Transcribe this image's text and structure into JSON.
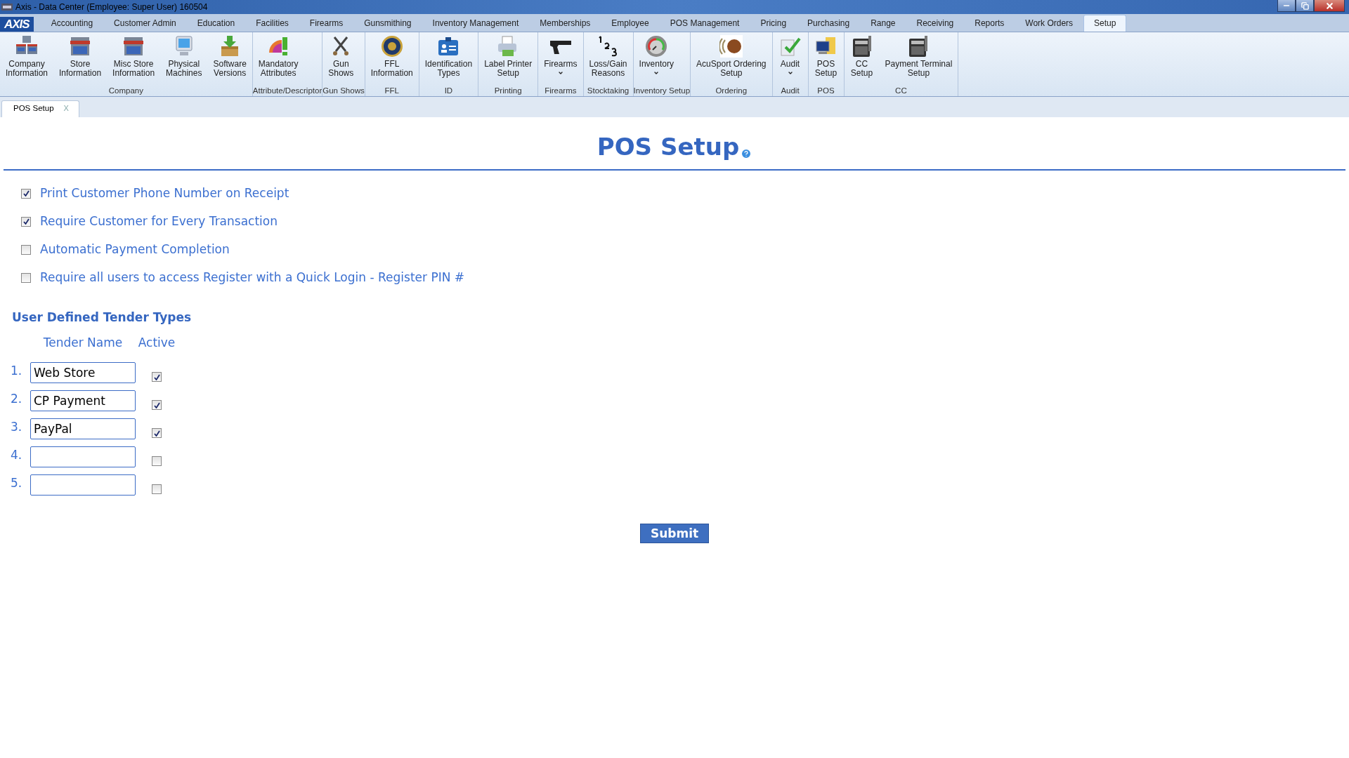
{
  "window": {
    "title": "Axis - Data Center  (Employee: Super User) 160504"
  },
  "menu": {
    "logo": "AXIS",
    "tabs": [
      {
        "label": "Accounting",
        "selected": false
      },
      {
        "label": "Customer Admin",
        "selected": false
      },
      {
        "label": "Education",
        "selected": false
      },
      {
        "label": "Facilities",
        "selected": false
      },
      {
        "label": "Firearms",
        "selected": false
      },
      {
        "label": "Gunsmithing",
        "selected": false
      },
      {
        "label": "Inventory Management",
        "selected": false
      },
      {
        "label": "Memberships",
        "selected": false
      },
      {
        "label": "Employee",
        "selected": false
      },
      {
        "label": "POS Management",
        "selected": false
      },
      {
        "label": "Pricing",
        "selected": false
      },
      {
        "label": "Purchasing",
        "selected": false
      },
      {
        "label": "Range",
        "selected": false
      },
      {
        "label": "Receiving",
        "selected": false
      },
      {
        "label": "Reports",
        "selected": false
      },
      {
        "label": "Work Orders",
        "selected": false
      },
      {
        "label": "Setup",
        "selected": true
      }
    ]
  },
  "ribbon": [
    {
      "group": "Company",
      "items": [
        {
          "label": [
            "Company",
            "Information"
          ],
          "kind": "buildings",
          "dropdown": false
        },
        {
          "label": [
            "Store",
            "Information"
          ],
          "kind": "store",
          "dropdown": false
        },
        {
          "label": [
            "Misc Store",
            "Information"
          ],
          "kind": "store",
          "dropdown": false
        },
        {
          "label": [
            "Physical",
            "Machines"
          ],
          "kind": "monitor",
          "dropdown": false
        },
        {
          "label": [
            "Software",
            "Versions"
          ],
          "kind": "box",
          "dropdown": false
        }
      ]
    },
    {
      "group": "Attribute/Descriptor",
      "items": [
        {
          "label": [
            "Mandatory",
            "Attributes"
          ],
          "kind": "palette",
          "dropdown": false
        }
      ]
    },
    {
      "group": "Gun Shows",
      "items": [
        {
          "label": [
            "Gun",
            "Shows"
          ],
          "kind": "pistols",
          "dropdown": false
        }
      ]
    },
    {
      "group": "FFL",
      "items": [
        {
          "label": [
            "FFL",
            "Information"
          ],
          "kind": "seal",
          "dropdown": false
        }
      ]
    },
    {
      "group": "ID",
      "items": [
        {
          "label": [
            "Identification",
            "Types"
          ],
          "kind": "idcard",
          "dropdown": false
        }
      ]
    },
    {
      "group": "Printing",
      "items": [
        {
          "label": [
            "Label Printer",
            "Setup"
          ],
          "kind": "printer",
          "dropdown": false
        }
      ]
    },
    {
      "group": "Firearms",
      "items": [
        {
          "label": [
            "Firearms"
          ],
          "kind": "pistol",
          "dropdown": true
        }
      ]
    },
    {
      "group": "Stocktaking",
      "items": [
        {
          "label": [
            "Loss/Gain",
            "Reasons"
          ],
          "kind": "numbers",
          "dropdown": false
        }
      ]
    },
    {
      "group": "Inventory Setup",
      "items": [
        {
          "label": [
            "Inventory"
          ],
          "kind": "gauge",
          "dropdown": true
        }
      ]
    },
    {
      "group": "Ordering",
      "items": [
        {
          "label": [
            "AcuSport Ordering",
            "Setup"
          ],
          "kind": "acusport",
          "dropdown": false
        }
      ]
    },
    {
      "group": "Audit",
      "items": [
        {
          "label": [
            "Audit"
          ],
          "kind": "check",
          "dropdown": true
        }
      ]
    },
    {
      "group": "POS",
      "items": [
        {
          "label": [
            "POS",
            "Setup"
          ],
          "kind": "pos",
          "dropdown": false
        }
      ]
    },
    {
      "group": "CC",
      "items": [
        {
          "label": [
            "CC",
            "Setup"
          ],
          "kind": "terminal",
          "dropdown": false
        },
        {
          "label": [
            "Payment Terminal",
            "Setup"
          ],
          "kind": "terminal",
          "dropdown": false
        }
      ]
    }
  ],
  "doc_tabs": [
    {
      "label": "POS Setup",
      "close": "X",
      "selected": true
    }
  ],
  "page": {
    "title": "POS Setup",
    "options": [
      {
        "label": "Print Customer Phone Number on Receipt",
        "checked": true
      },
      {
        "label": "Require Customer for Every Transaction",
        "checked": true
      },
      {
        "label": "Automatic Payment Completion",
        "checked": false
      },
      {
        "label": "Require all users to access Register with a Quick Login - Register PIN #",
        "checked": false
      }
    ],
    "tender_section": {
      "title": "User Defined Tender Types",
      "columns": [
        "Tender Name",
        "Active"
      ],
      "rows": [
        {
          "number": "1.",
          "value": "Web Store",
          "active": true
        },
        {
          "number": "2.",
          "value": "CP Payment",
          "active": true
        },
        {
          "number": "3.",
          "value": "PayPal",
          "active": true
        },
        {
          "number": "4.",
          "active": false
        },
        {
          "number": "5.",
          "active": false
        }
      ]
    },
    "submit": "Submit"
  }
}
